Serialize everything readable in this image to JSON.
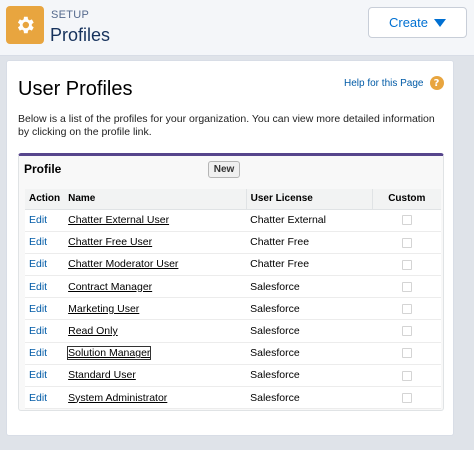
{
  "header": {
    "overline": "SETUP",
    "title": "Profiles",
    "icon": "gear-icon",
    "icon_bg": "#e8a53f",
    "create_label": "Create"
  },
  "page": {
    "title": "User Profiles",
    "help_link": "Help for this Page",
    "help_icon": "?",
    "description": "Below is a list of the profiles for your organization. You can view more detailed information by clicking on the profile link."
  },
  "profile_block": {
    "title": "Profile",
    "new_label": "New",
    "accent_color": "#56458c",
    "columns": {
      "action": "Action",
      "name": "Name",
      "license": "User License",
      "custom": "Custom"
    },
    "rows": [
      {
        "action": "Edit",
        "name": "Chatter External User",
        "license": "Chatter External",
        "custom": false
      },
      {
        "action": "Edit",
        "name": "Chatter Free User",
        "license": "Chatter Free",
        "custom": false
      },
      {
        "action": "Edit",
        "name": "Chatter Moderator User",
        "license": "Chatter Free",
        "custom": false
      },
      {
        "action": "Edit",
        "name": "Contract Manager",
        "license": "Salesforce",
        "custom": false
      },
      {
        "action": "Edit",
        "name": "Marketing User",
        "license": "Salesforce",
        "custom": false
      },
      {
        "action": "Edit",
        "name": "Read Only",
        "license": "Salesforce",
        "custom": false
      },
      {
        "action": "Edit",
        "name": "Solution Manager",
        "license": "Salesforce",
        "custom": false
      },
      {
        "action": "Edit",
        "name": "Standard User",
        "license": "Salesforce",
        "custom": false
      },
      {
        "action": "Edit",
        "name": "System Administrator",
        "license": "Salesforce",
        "custom": false
      }
    ]
  }
}
